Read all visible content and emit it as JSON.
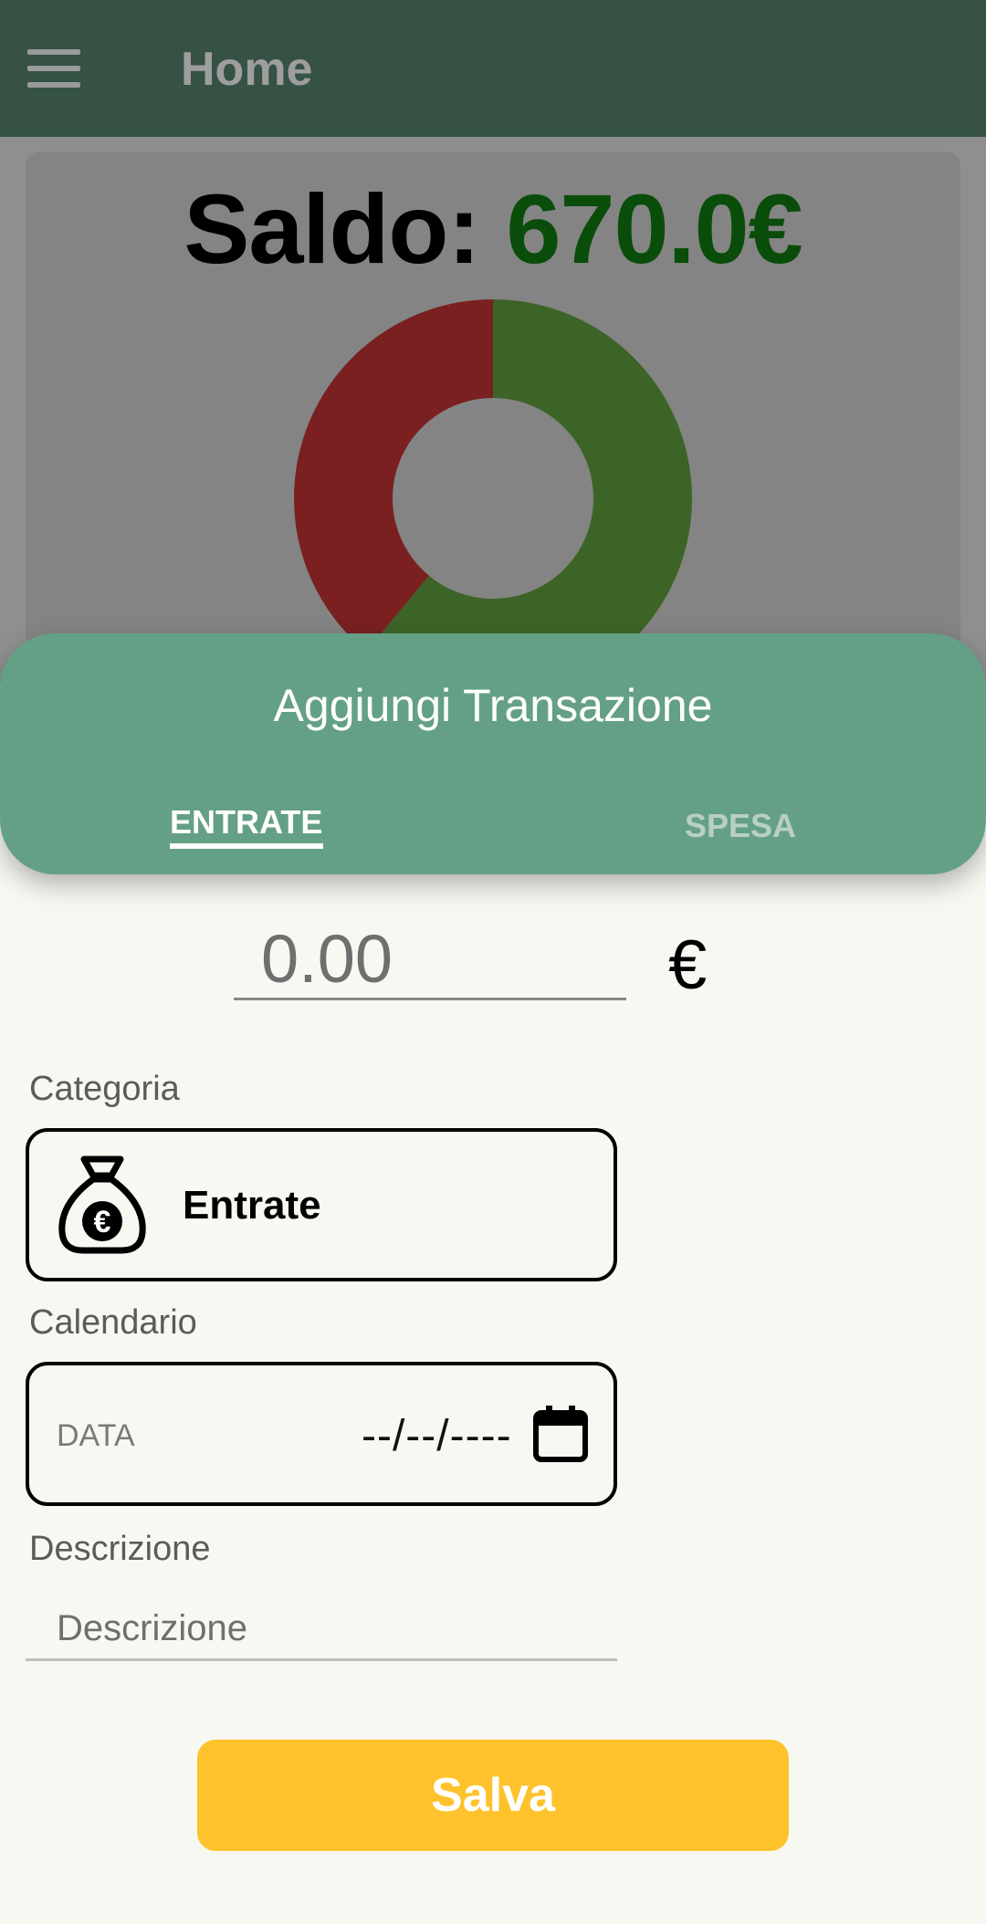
{
  "appbar": {
    "title": "Home",
    "menu_icon": "hamburger-menu-icon"
  },
  "summary": {
    "balance_label": "Saldo:",
    "balance_value": "670.0€",
    "balance_color": "#0a4d0a"
  },
  "chart_data": {
    "type": "pie",
    "donut": true,
    "slices": [
      {
        "label": "Entrate",
        "value": 0.61,
        "color": "#3d6427"
      },
      {
        "label": "Spesa",
        "value": 0.39,
        "color": "#7a2020"
      }
    ]
  },
  "sheet": {
    "title": "Aggiungi Transazione",
    "tabs": [
      {
        "label": "ENTRATE",
        "selected": true
      },
      {
        "label": "SPESA",
        "selected": false
      }
    ]
  },
  "form": {
    "amount_placeholder": "0.00",
    "currency_symbol": "€",
    "category_label": "Categoria",
    "category_value": "Entrate",
    "category_icon": "money-bag-euro-icon",
    "calendar_label": "Calendario",
    "date_label": "DATA",
    "date_value": "--/--/----",
    "date_icon": "calendar-icon",
    "description_label": "Descrizione",
    "description_placeholder": "Descrizione",
    "save_label": "Salva"
  },
  "colors": {
    "appbar": "#355244",
    "sheet_header": "#64a086",
    "save_button": "#fec22c",
    "background": "#f8f8f3"
  }
}
